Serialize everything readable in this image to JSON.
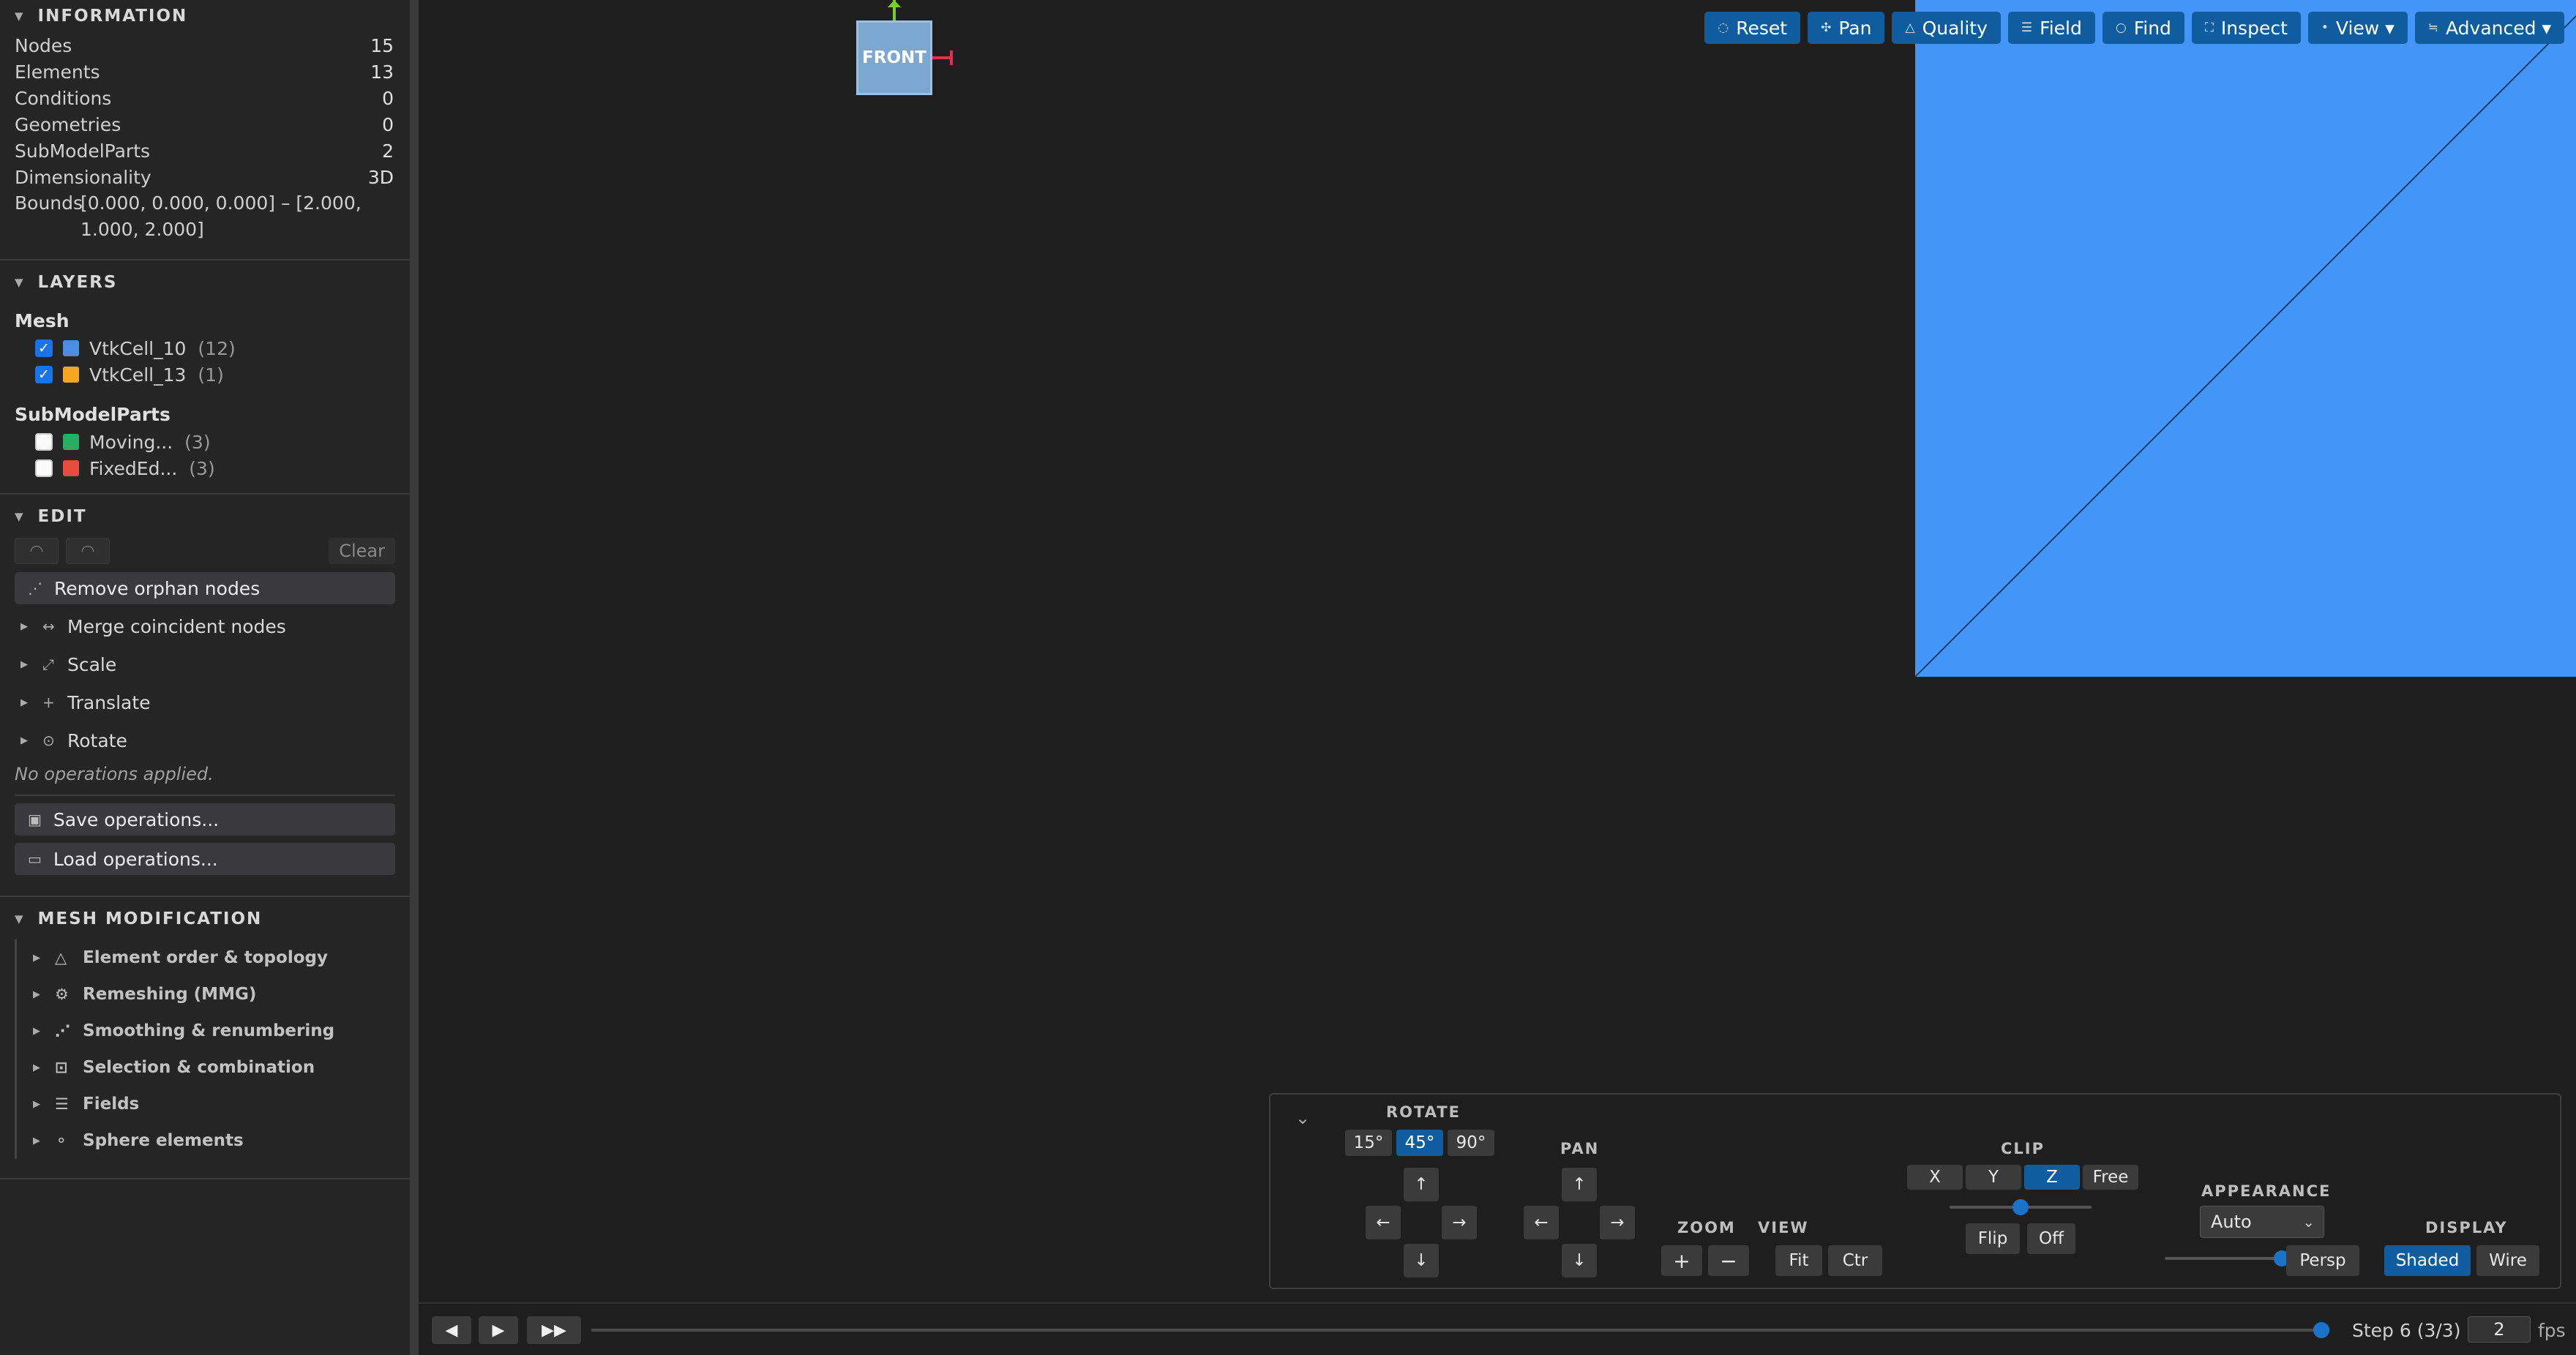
{
  "information": {
    "title": "INFORMATION",
    "rows": [
      {
        "label": "Nodes",
        "value": "15"
      },
      {
        "label": "Elements",
        "value": "13"
      },
      {
        "label": "Conditions",
        "value": "0"
      },
      {
        "label": "Geometries",
        "value": "0"
      },
      {
        "label": "SubModelParts",
        "value": "2"
      },
      {
        "label": "Dimensionality",
        "value": "3D"
      }
    ],
    "bounds_label": "Bounds",
    "bounds_value": "[0.000, 0.000, 0.000] – [2.000, 1.000, 2.000]"
  },
  "layers": {
    "title": "LAYERS",
    "mesh_title": "Mesh",
    "mesh": [
      {
        "name": "VtkCell_10",
        "count": "(12)",
        "color": "#4a90e2",
        "checked": true
      },
      {
        "name": "VtkCell_13",
        "count": "(1)",
        "color": "#f5a623",
        "checked": true
      }
    ],
    "smp_title": "SubModelParts",
    "smp": [
      {
        "name": "Moving...",
        "count": "(3)",
        "color": "#27ae60",
        "checked": false
      },
      {
        "name": "FixedEd...",
        "count": "(3)",
        "color": "#e74c3c",
        "checked": false
      }
    ]
  },
  "edit": {
    "title": "EDIT",
    "clear_label": "Clear",
    "remove_orphan": "Remove orphan nodes",
    "ops": [
      {
        "label": "Merge coincident nodes",
        "icon": "merge-icon"
      },
      {
        "label": "Scale",
        "icon": "scale-icon"
      },
      {
        "label": "Translate",
        "icon": "translate-icon"
      },
      {
        "label": "Rotate",
        "icon": "rotate-icon"
      }
    ],
    "note": "No operations applied.",
    "save_label": "Save operations...",
    "load_label": "Load operations..."
  },
  "mesh_mod": {
    "title": "MESH MODIFICATION",
    "items": [
      {
        "label": "Element order & topology",
        "icon": "triangle-icon"
      },
      {
        "label": "Remeshing (MMG)",
        "icon": "remesh-icon"
      },
      {
        "label": "Smoothing & renumbering",
        "icon": "smoothing-icon"
      },
      {
        "label": "Selection & combination",
        "icon": "selection-icon"
      },
      {
        "label": "Fields",
        "icon": "fields-icon"
      },
      {
        "label": "Sphere elements",
        "icon": "sphere-icon"
      }
    ]
  },
  "viewport": {
    "cube_label": "FRONT",
    "mesh_color": "#4396f7",
    "toolbar": [
      {
        "label": "Reset",
        "icon": "reset-icon"
      },
      {
        "label": "Pan",
        "icon": "pan-icon"
      },
      {
        "label": "Quality",
        "icon": "quality-icon"
      },
      {
        "label": "Field",
        "icon": "field-icon"
      },
      {
        "label": "Find",
        "icon": "find-icon"
      },
      {
        "label": "Inspect",
        "icon": "inspect-icon"
      },
      {
        "label": "View ▾",
        "icon": "view-icon"
      },
      {
        "label": "Advanced ▾",
        "icon": "advanced-icon"
      }
    ]
  },
  "controls": {
    "collapse": "⌄",
    "rotate": {
      "title": "ROTATE",
      "angles": [
        "15°",
        "45°",
        "90°"
      ],
      "active": "45°"
    },
    "pan": {
      "title": "PAN"
    },
    "arrows": {
      "up": "↑",
      "down": "↓",
      "left": "←",
      "right": "→"
    },
    "zoom": {
      "title": "ZOOM",
      "in": "+",
      "out": "−"
    },
    "view": {
      "title": "VIEW",
      "fit": "Fit",
      "ctr": "Ctr"
    },
    "clip": {
      "title": "CLIP",
      "axes": [
        "X",
        "Y",
        "Z",
        "Free"
      ],
      "active": "Z",
      "flip": "Flip",
      "off": "Off",
      "slider_fraction": 0.5
    },
    "appearance": {
      "title": "APPEARANCE",
      "select": "Auto",
      "persp": "Persp",
      "slider_fraction": 1.0
    },
    "display": {
      "title": "DISPLAY",
      "shaded": "Shaded",
      "wire": "Wire",
      "active": "Shaded"
    }
  },
  "playback": {
    "prev": "◀",
    "play": "▶",
    "next": "▶▶",
    "step_text": "Step 6 (3/3)",
    "fps_value": "2",
    "fps_label": "fps",
    "progress_fraction": 1.0
  }
}
